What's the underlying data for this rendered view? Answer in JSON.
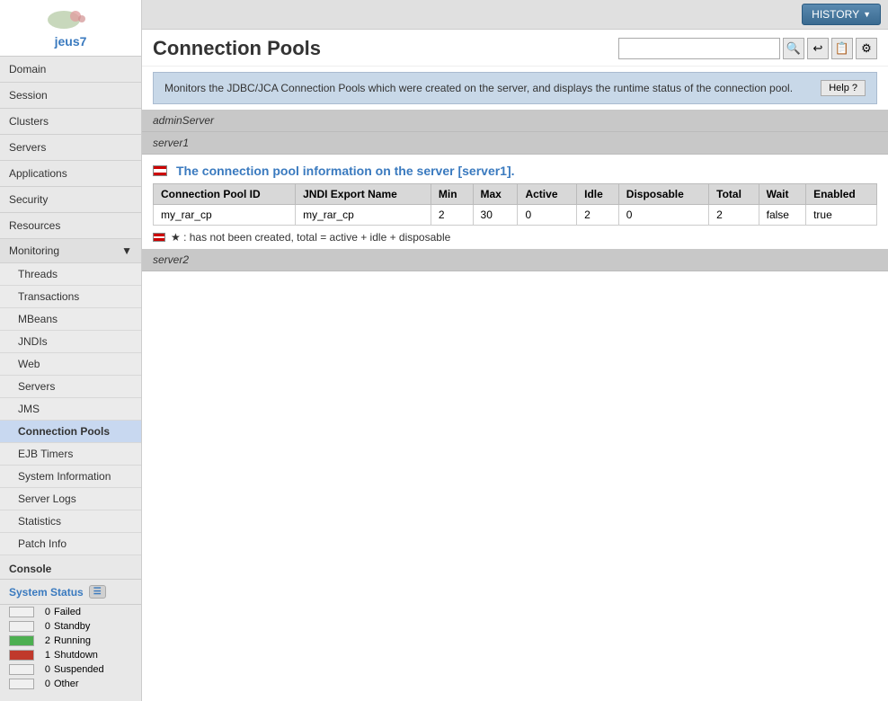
{
  "sidebar": {
    "logo_text": "jeus7",
    "items": [
      {
        "label": "Domain",
        "id": "domain"
      },
      {
        "label": "Session",
        "id": "session"
      },
      {
        "label": "Clusters",
        "id": "clusters"
      },
      {
        "label": "Servers",
        "id": "servers"
      },
      {
        "label": "Applications",
        "id": "applications"
      },
      {
        "label": "Security",
        "id": "security"
      },
      {
        "label": "Resources",
        "id": "resources"
      }
    ],
    "monitoring_label": "Monitoring",
    "monitoring_items": [
      {
        "label": "Threads",
        "id": "threads",
        "active": false
      },
      {
        "label": "Transactions",
        "id": "transactions",
        "active": false
      },
      {
        "label": "MBeans",
        "id": "mbeans",
        "active": false
      },
      {
        "label": "JNDIs",
        "id": "jndis",
        "active": false
      },
      {
        "label": "Web",
        "id": "web",
        "active": false
      },
      {
        "label": "Servers",
        "id": "servers-mon",
        "active": false
      },
      {
        "label": "JMS",
        "id": "jms",
        "active": false
      },
      {
        "label": "Connection Pools",
        "id": "connection-pools",
        "active": true
      },
      {
        "label": "EJB Timers",
        "id": "ejb-timers",
        "active": false
      },
      {
        "label": "System Information",
        "id": "system-info",
        "active": false
      },
      {
        "label": "Server Logs",
        "id": "server-logs",
        "active": false
      },
      {
        "label": "Statistics",
        "id": "statistics",
        "active": false
      },
      {
        "label": "Patch Info",
        "id": "patch-info",
        "active": false
      }
    ],
    "console_label": "Console",
    "system_status_label": "System Status",
    "status_items": [
      {
        "label": "Failed",
        "count": 0,
        "type": "failed"
      },
      {
        "label": "Standby",
        "count": 0,
        "type": "standby"
      },
      {
        "label": "Running",
        "count": 2,
        "type": "running"
      },
      {
        "label": "Shutdown",
        "count": 1,
        "type": "shutdown"
      },
      {
        "label": "Suspended",
        "count": 0,
        "type": "suspended"
      },
      {
        "label": "Other",
        "count": 0,
        "type": "other"
      }
    ]
  },
  "header": {
    "history_label": "HISTORY",
    "page_title": "Connection Pools",
    "search_placeholder": "",
    "info_text": "Monitors the JDBC/JCA Connection Pools which were created on the server, and displays the runtime status of the connection pool.",
    "help_label": "Help ?"
  },
  "content": {
    "admin_server_label": "adminServer",
    "server1_label": "server1",
    "server2_label": "server2",
    "section_title": "The connection pool information on the server [server1].",
    "note_text": "★ : has not been created, total = active + idle + disposable",
    "table": {
      "columns": [
        "Connection Pool ID",
        "JNDI Export Name",
        "Min",
        "Max",
        "Active",
        "Idle",
        "Disposable",
        "Total",
        "Wait",
        "Enabled"
      ],
      "rows": [
        {
          "pool_id": "my_rar_cp",
          "jndi": "my_rar_cp",
          "min": "2",
          "max": "30",
          "active": "0",
          "idle": "2",
          "disposable": "0",
          "total": "2",
          "wait": "false",
          "enabled": "true"
        }
      ]
    }
  }
}
